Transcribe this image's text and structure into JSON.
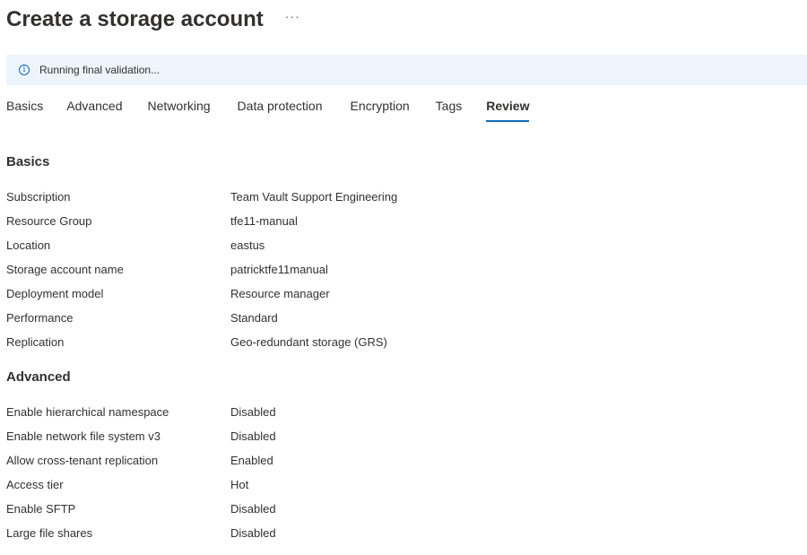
{
  "header": {
    "title": "Create a storage account",
    "more_label": "···"
  },
  "notice": {
    "icon": "info-icon",
    "text": "Running final validation..."
  },
  "tabs": [
    {
      "label": "Basics"
    },
    {
      "label": "Advanced"
    },
    {
      "label": "Networking"
    },
    {
      "label": "Data protection"
    },
    {
      "label": "Encryption"
    },
    {
      "label": "Tags"
    },
    {
      "label": "Review",
      "active": true
    }
  ],
  "basics": {
    "title": "Basics",
    "rows": [
      {
        "label": "Subscription",
        "value": "Team Vault Support Engineering"
      },
      {
        "label": "Resource Group",
        "value": "tfe11-manual"
      },
      {
        "label": "Location",
        "value": "eastus"
      },
      {
        "label": "Storage account name",
        "value": "patricktfe11manual"
      },
      {
        "label": "Deployment model",
        "value": "Resource manager"
      },
      {
        "label": "Performance",
        "value": "Standard"
      },
      {
        "label": "Replication",
        "value": "Geo-redundant storage (GRS)"
      }
    ]
  },
  "advanced": {
    "title": "Advanced",
    "rows": [
      {
        "label": "Enable hierarchical namespace",
        "value": "Disabled"
      },
      {
        "label": "Enable network file system v3",
        "value": "Disabled"
      },
      {
        "label": "Allow cross-tenant replication",
        "value": "Enabled"
      },
      {
        "label": "Access tier",
        "value": "Hot"
      },
      {
        "label": "Enable SFTP",
        "value": "Disabled"
      },
      {
        "label": "Large file shares",
        "value": "Disabled"
      }
    ]
  },
  "colors": {
    "accent": "#0f6cbd",
    "notice_background": "#eef4fb",
    "text": "#323130"
  }
}
